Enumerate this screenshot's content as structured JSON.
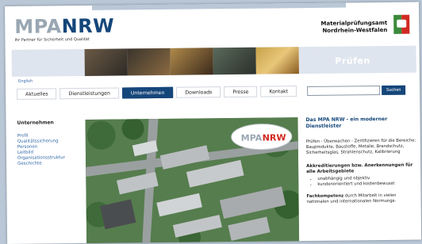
{
  "header": {
    "logo": {
      "mpa": "MPA",
      "nrw": "NRW"
    },
    "logo_subtitle": "Ihr Partner für Sicherheit und Qualität",
    "org_name_line1": "Materialprüfungsamt",
    "org_name_line2": "Nordrhein-Westfalen"
  },
  "banner": {
    "word": "Prüfen"
  },
  "language_link": "English",
  "nav": {
    "tabs": [
      "Aktuelles",
      "Dienstleistungen",
      "Unternehmen",
      "Downloads",
      "Presse",
      "Kontakt"
    ],
    "active_tab": "Unternehmen"
  },
  "search": {
    "placeholder": "",
    "button_label": "Suchen"
  },
  "sidebar": {
    "heading": "Unternehmen",
    "items": [
      "Profil",
      "Qualitätssicherung",
      "Personen",
      "Leitbild",
      "Organisationsstruktur",
      "Geschichte"
    ]
  },
  "photo": {
    "badge_mpa": "MPA",
    "badge_nrw": "NRW"
  },
  "right_panel": {
    "title": "Das MPA NRW - ein moderner Dienstleister",
    "paragraph": "Prüfen - Überwachen - Zertifizieren für die Bereiche: Bauprodukte, Baustoffe, Metalle, Brandschutz, Sicherheitsglas, Strahlenschutz, Kalibrierung",
    "accreditation_heading": "Akkreditierungen bzw. Anerkennungen für alle Arbeitsgebiete",
    "bullets": [
      "unabhängig und objektiv",
      "kundenorientiert und kostenbewusst"
    ],
    "expertise_lead": "Fachkompetenz",
    "expertise_text": " durch Mitarbeit in vielen nationalen und internationalen Normungs-"
  },
  "colors": {
    "brand_blue": "#15467a",
    "link_blue": "#2e66a6",
    "logo_grey": "#9aa7b3"
  }
}
